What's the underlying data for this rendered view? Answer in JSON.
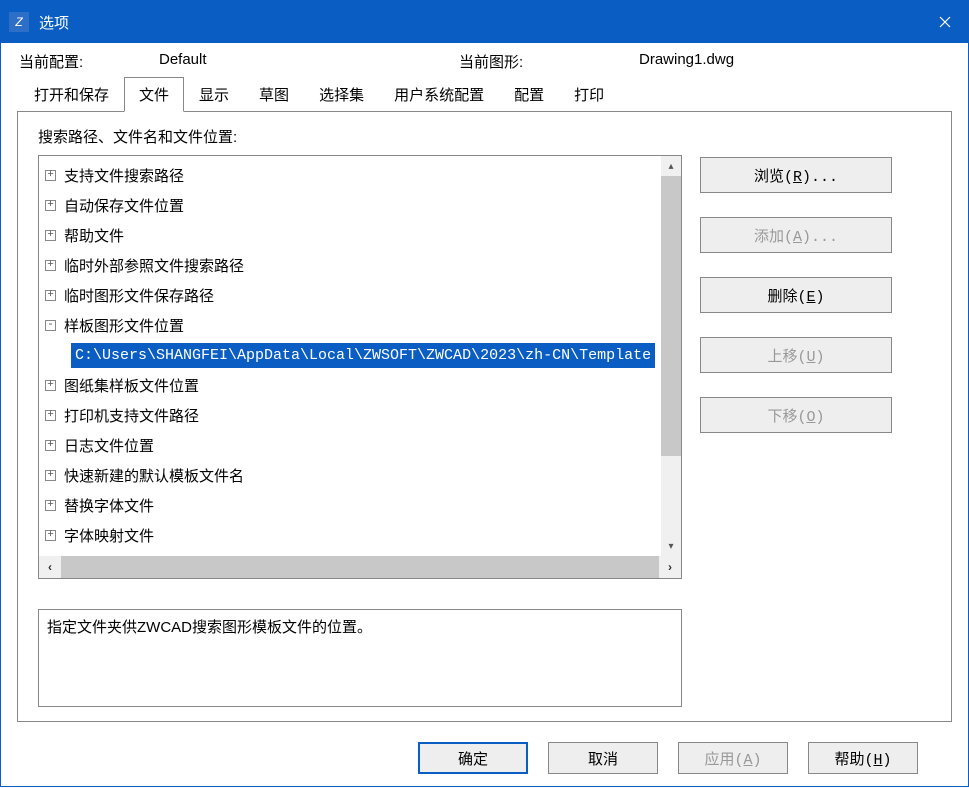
{
  "window": {
    "title": "选项",
    "icon_text": "Z"
  },
  "info": {
    "profile_label": "当前配置:",
    "profile_value": "Default",
    "drawing_label": "当前图形:",
    "drawing_value": "Drawing1.dwg"
  },
  "tabs": [
    {
      "label": "打开和保存",
      "active": false
    },
    {
      "label": "文件",
      "active": true
    },
    {
      "label": "显示",
      "active": false
    },
    {
      "label": "草图",
      "active": false
    },
    {
      "label": "选择集",
      "active": false
    },
    {
      "label": "用户系统配置",
      "active": false
    },
    {
      "label": "配置",
      "active": false
    },
    {
      "label": "打印",
      "active": false
    }
  ],
  "panel": {
    "heading": "搜索路径、文件名和文件位置:"
  },
  "tree": {
    "items": [
      {
        "expander": "+",
        "label": "支持文件搜索路径",
        "level": 0
      },
      {
        "expander": "+",
        "label": "自动保存文件位置",
        "level": 0
      },
      {
        "expander": "+",
        "label": "帮助文件",
        "level": 0
      },
      {
        "expander": "+",
        "label": "临时外部参照文件搜索路径",
        "level": 0
      },
      {
        "expander": "+",
        "label": "临时图形文件保存路径",
        "level": 0
      },
      {
        "expander": "-",
        "label": "样板图形文件位置",
        "level": 0
      },
      {
        "expander": "",
        "label": "C:\\Users\\SHANGFEI\\AppData\\Local\\ZWSOFT\\ZWCAD\\2023\\zh-CN\\Template",
        "level": 1,
        "selected": true
      },
      {
        "expander": "+",
        "label": "图纸集样板文件位置",
        "level": 0
      },
      {
        "expander": "+",
        "label": "打印机支持文件路径",
        "level": 0
      },
      {
        "expander": "+",
        "label": "日志文件位置",
        "level": 0
      },
      {
        "expander": "+",
        "label": "快速新建的默认模板文件名",
        "level": 0
      },
      {
        "expander": "+",
        "label": "替换字体文件",
        "level": 0
      },
      {
        "expander": "+",
        "label": "字体映射文件",
        "level": 0
      }
    ]
  },
  "side_buttons": {
    "browse": "浏览(R)...",
    "add": "添加(A)...",
    "delete": "删除(E)",
    "moveup": "上移(U)",
    "movedown": "下移(O)"
  },
  "description": "指定文件夹供ZWCAD搜索图形模板文件的位置。",
  "bottom_buttons": {
    "ok": "确定",
    "cancel": "取消",
    "apply": "应用(A)",
    "help": "帮助(H)"
  }
}
